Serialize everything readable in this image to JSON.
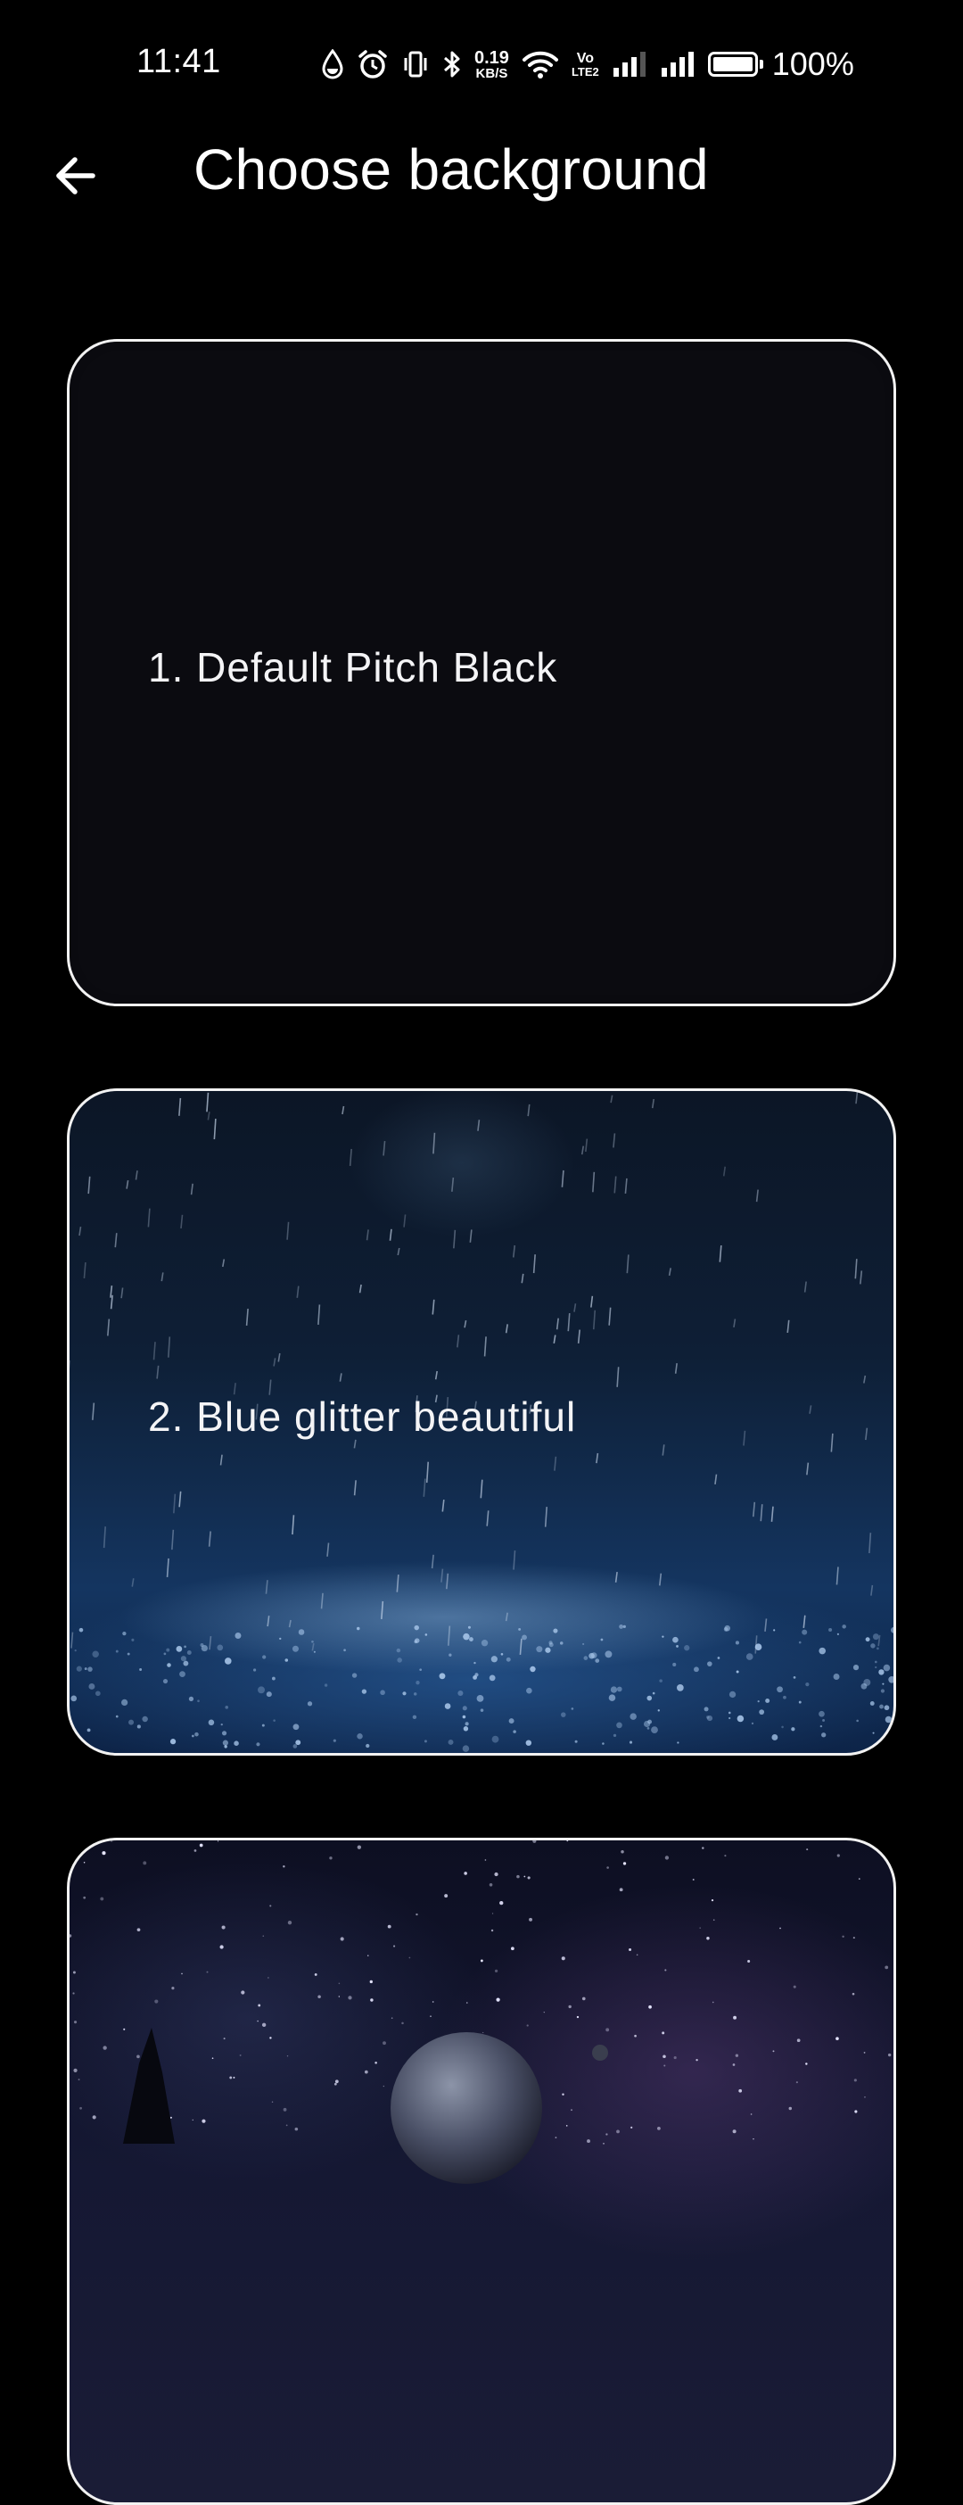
{
  "status_bar": {
    "time": "11:41",
    "net_speed_value": "0.19",
    "net_speed_unit": "KB/S",
    "volte_top": "Vo",
    "volte_bottom": "LTE2",
    "battery_percent": "100%",
    "battery_level": 1.0,
    "icons": [
      "data-saver-icon",
      "alarm-icon",
      "vibrate-icon",
      "bluetooth-icon",
      "wifi-icon",
      "signal-icon",
      "signal-icon",
      "battery-icon"
    ]
  },
  "app_bar": {
    "back_icon": "arrow-left-icon",
    "title": "Choose background"
  },
  "backgrounds": [
    {
      "label": "1. Default Pitch Black"
    },
    {
      "label": "2. Blue glitter beautiful"
    },
    {
      "label": ""
    }
  ],
  "colors": {
    "background": "#000000",
    "card_border": "#f2f2f2",
    "text": "#ffffff"
  }
}
